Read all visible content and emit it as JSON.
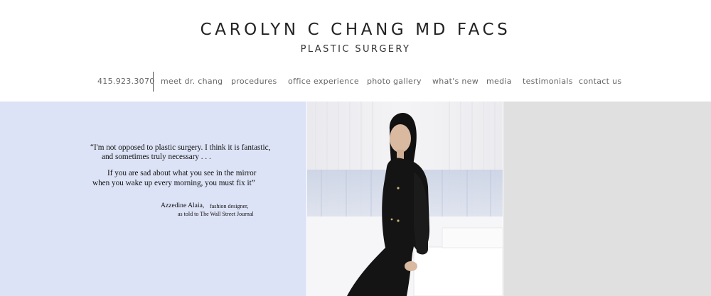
{
  "header": {
    "title": "CAROLYN C CHANG MD FACS",
    "subtitle": "PLASTIC SURGERY"
  },
  "nav": {
    "phone": "415.923.3070",
    "items": [
      "meet dr. chang",
      "procedures",
      "office experience",
      "photo gallery",
      "what's new",
      "media",
      "testimonials",
      "contact us"
    ]
  },
  "quote": {
    "line1": "“I'm not opposed to plastic surgery. I think it is fantastic,",
    "line2": "and sometimes truly necessary . . .",
    "line3": "If you are sad about what you see in the mirror",
    "line4": "when you wake up every morning, you must fix it”",
    "author": "Azzedine Alaia,",
    "author_role": "fashion designer,",
    "source": "as told to The Wall Street Journal"
  },
  "colors": {
    "quote_panel": "#dde3f6",
    "grey_panel": "#e0e0e1",
    "nav_text": "#666666"
  }
}
